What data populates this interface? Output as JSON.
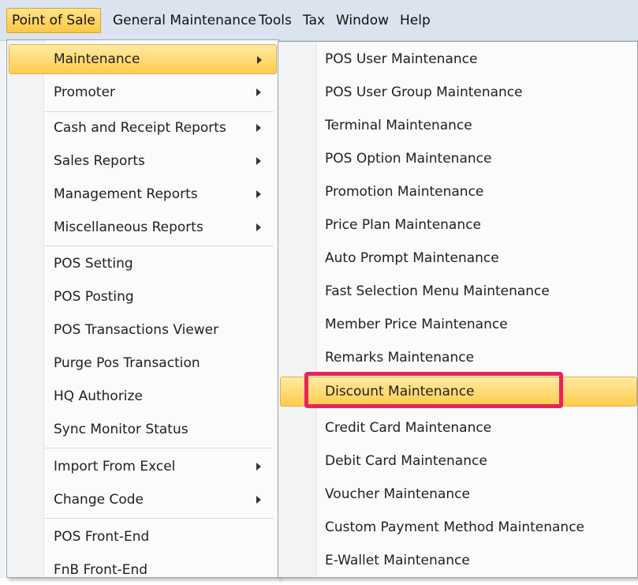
{
  "menubar": {
    "items": [
      "Point of Sale",
      "General Maintenance",
      "Tools",
      "Tax",
      "Window",
      "Help"
    ]
  },
  "pos_menu": {
    "items": [
      {
        "label": "Maintenance",
        "has_submenu": true,
        "active": true
      },
      {
        "label": "Promoter",
        "has_submenu": true
      },
      {
        "label": "Cash and Receipt Reports",
        "has_submenu": true
      },
      {
        "label": "Sales Reports",
        "has_submenu": true
      },
      {
        "label": "Management Reports",
        "has_submenu": true
      },
      {
        "label": "Miscellaneous Reports",
        "has_submenu": true
      },
      {
        "label": "POS Setting"
      },
      {
        "label": "POS Posting"
      },
      {
        "label": "POS Transactions Viewer"
      },
      {
        "label": "Purge Pos Transaction"
      },
      {
        "label": "HQ Authorize"
      },
      {
        "label": "Sync Monitor Status"
      },
      {
        "label": "Import From Excel",
        "has_submenu": true
      },
      {
        "label": "Change Code",
        "has_submenu": true
      },
      {
        "label": "POS Front-End"
      },
      {
        "label": "FnB Front-End"
      }
    ]
  },
  "maintenance_menu": {
    "items": [
      {
        "label": "POS User Maintenance"
      },
      {
        "label": "POS User Group Maintenance"
      },
      {
        "label": "Terminal Maintenance"
      },
      {
        "label": "POS Option Maintenance"
      },
      {
        "label": "Promotion Maintenance"
      },
      {
        "label": "Price Plan Maintenance"
      },
      {
        "label": "Auto Prompt Maintenance"
      },
      {
        "label": "Fast Selection Menu Maintenance"
      },
      {
        "label": "Member Price Maintenance"
      },
      {
        "label": "Remarks Maintenance"
      },
      {
        "label": "Discount Maintenance",
        "active": true
      },
      {
        "label": "Credit Card Maintenance"
      },
      {
        "label": "Debit Card Maintenance"
      },
      {
        "label": "Voucher Maintenance"
      },
      {
        "label": "Custom Payment Method Maintenance"
      },
      {
        "label": "E-Wallet Maintenance"
      }
    ]
  },
  "colors": {
    "menubar_bg": "#dbe3ee",
    "active_gradient_top": "#ffeaa2",
    "active_gradient_bottom": "#ffcc4d",
    "highlight_box": "#e8245a"
  }
}
